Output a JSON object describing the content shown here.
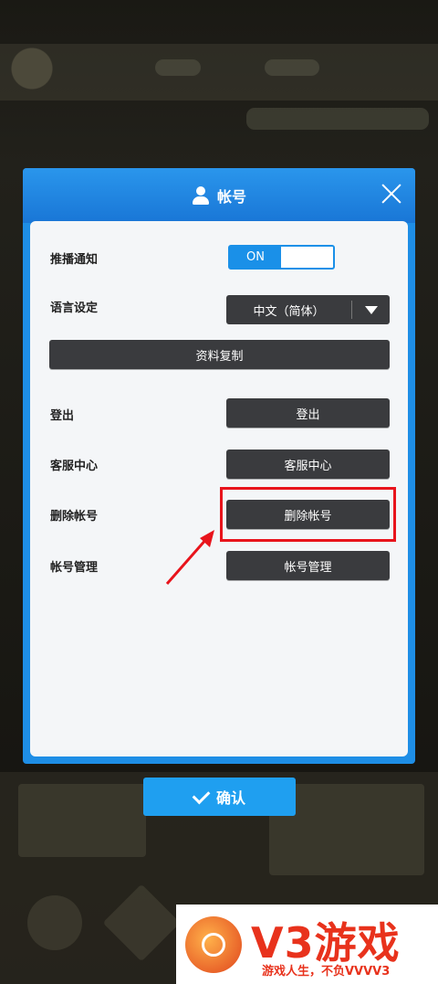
{
  "dialog": {
    "title": "帐号",
    "header_color": "#1e8ee6"
  },
  "settings": {
    "push_label": "推播通知",
    "push_toggle": "ON",
    "language_label": "语言设定",
    "language_value": "中文（简体）",
    "copy_button": "资料复制",
    "logout_label": "登出",
    "logout_button": "登出",
    "support_label": "客服中心",
    "support_button": "客服中心",
    "delete_label": "删除帐号",
    "delete_button": "删除帐号",
    "manage_label": "帐号管理",
    "manage_button": "帐号管理"
  },
  "confirm_button": "确认",
  "watermark": {
    "brand": "V3游戏",
    "slogan": "游戏人生，不负VVVV3"
  },
  "annotation": {
    "highlight_color": "#e8141c"
  }
}
